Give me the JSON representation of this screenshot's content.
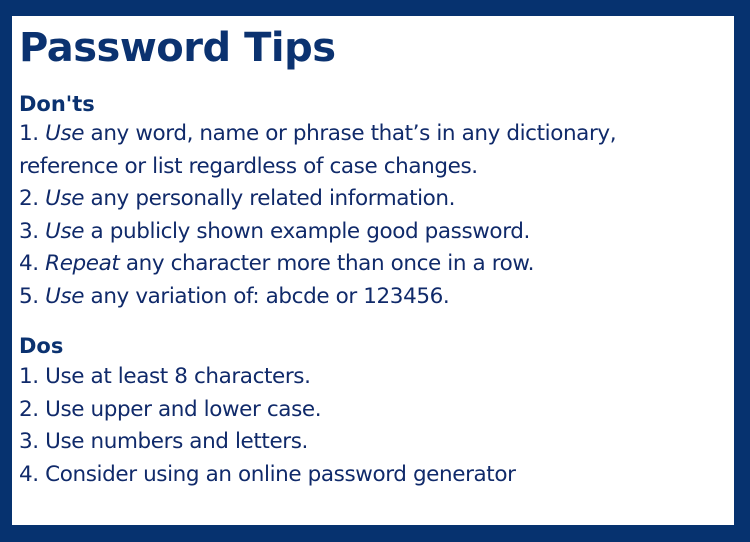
{
  "title": "Password Tips",
  "colors": {
    "border": "#06326f",
    "panel": "#ffffff",
    "text": "#0b2a66"
  },
  "donts": {
    "heading": "Don'ts",
    "items": [
      {
        "number": "1.",
        "emphasis": "Use",
        "rest": " any word, name or phrase that’s in any dictionary,"
      },
      {
        "number": "",
        "emphasis": "",
        "rest": "reference or list regardless of case changes."
      },
      {
        "number": "2.",
        "emphasis": "Use",
        "rest": " any personally related information."
      },
      {
        "number": "3.",
        "emphasis": "Use",
        "rest": " a publicly shown example good password."
      },
      {
        "number": "4.",
        "emphasis": "Repeat",
        "rest": " any character more than once in a row."
      },
      {
        "number": "5.",
        "emphasis": "Use",
        "rest": " any variation of: abcde or 123456."
      }
    ]
  },
  "dos": {
    "heading": "Dos",
    "items": [
      {
        "number": "1.",
        "text": "Use at least 8 characters."
      },
      {
        "number": "2.",
        "text": "Use upper and lower case."
      },
      {
        "number": "3.",
        "text": "Use numbers and letters."
      },
      {
        "number": "4.",
        "text": "Consider using an online password generator"
      }
    ]
  }
}
